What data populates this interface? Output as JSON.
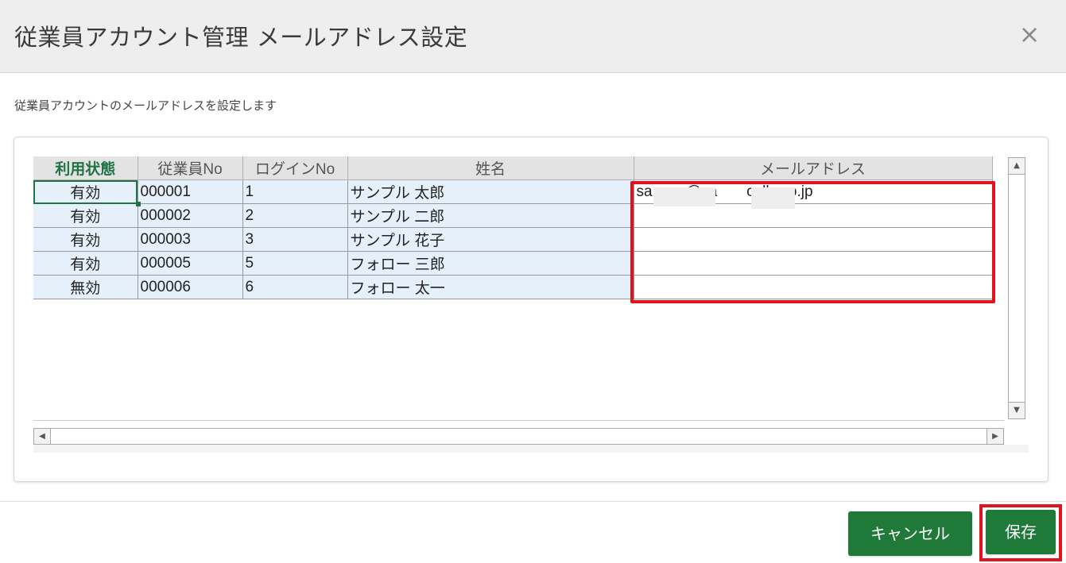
{
  "dialog": {
    "title": "従業員アカウント管理 メールアドレス設定",
    "close_icon": "×",
    "description": "従業員アカウントのメールアドレスを設定します"
  },
  "table": {
    "headers": [
      "利用状態",
      "従業員No",
      "ログインNo",
      "姓名",
      "メールアドレス"
    ],
    "rows": [
      {
        "status": "有効",
        "emp_no": "000001",
        "login_no": "1",
        "name": "サンプル 太郎",
        "email": "sa      o@sa       cells.co.jp"
      },
      {
        "status": "有効",
        "emp_no": "000002",
        "login_no": "2",
        "name": "サンプル 二郎",
        "email": ""
      },
      {
        "status": "有効",
        "emp_no": "000003",
        "login_no": "3",
        "name": "サンプル 花子",
        "email": ""
      },
      {
        "status": "有効",
        "emp_no": "000005",
        "login_no": "5",
        "name": "フォロー 三郎",
        "email": ""
      },
      {
        "status": "無効",
        "emp_no": "000006",
        "login_no": "6",
        "name": "フォロー 太一",
        "email": ""
      }
    ]
  },
  "scrollbars": {
    "up_icon": "▲",
    "down_icon": "▼",
    "left_icon": "◀",
    "right_icon": "▶"
  },
  "buttons": {
    "cancel_label": "キャンセル",
    "save_label": "保存"
  },
  "colors": {
    "accent_green": "#1f7a3a",
    "highlight_red": "#e0141e",
    "readonly_cell_bg": "#e5f0fa"
  }
}
